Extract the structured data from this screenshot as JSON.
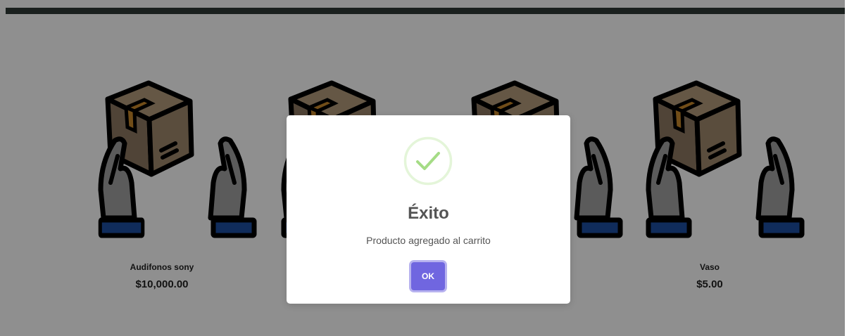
{
  "products": [
    {
      "name": "Audifonos sony",
      "price": "$10,000.00",
      "icon": "box-hands-icon"
    },
    {
      "name": "",
      "price": "",
      "icon": "box-hands-icon"
    },
    {
      "name": "",
      "price": "",
      "icon": "box-hands-icon"
    },
    {
      "name": "Vaso",
      "price": "$5.00",
      "icon": "box-hands-icon"
    }
  ],
  "dialog": {
    "icon": "success-check-icon",
    "title": "Éxito",
    "text": "Producto agregado al carrito",
    "confirm_label": "OK"
  },
  "colors": {
    "topbar": "#2f3a37",
    "box_face": "#a08a70",
    "box_side": "#8a7560",
    "tape": "#c98a2c",
    "cuff": "#1e4fa3",
    "hand": "#9a9a9a",
    "success": "#a5dc86",
    "confirm_button": "#7066e0"
  }
}
